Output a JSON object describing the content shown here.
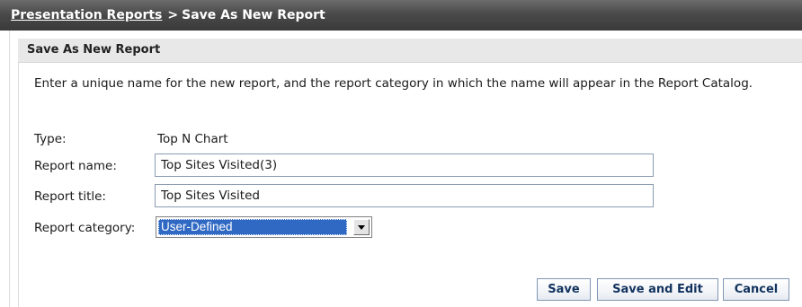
{
  "breadcrumb": {
    "parent_link": "Presentation Reports",
    "separator": ">",
    "current": "Save As New Report"
  },
  "panel": {
    "title": "Save As New Report",
    "instructions": "Enter a unique name for the new report, and the report category in which the name will appear in the Report Catalog."
  },
  "form": {
    "type_label": "Type:",
    "type_value": "Top N Chart",
    "name_label": "Report name:",
    "name_value": "Top Sites Visited(3)",
    "title_label": "Report title:",
    "title_value": "Top Sites Visited",
    "category_label": "Report category:",
    "category_selected": "User-Defined"
  },
  "buttons": {
    "save": "Save",
    "save_and_edit": "Save and Edit",
    "cancel": "Cancel"
  },
  "colors": {
    "header_bar": "#4a4a4a",
    "selection_highlight": "#3069c4",
    "button_text": "#12335e"
  },
  "icons": {
    "dropdown_arrow": "chevron-down-icon"
  }
}
